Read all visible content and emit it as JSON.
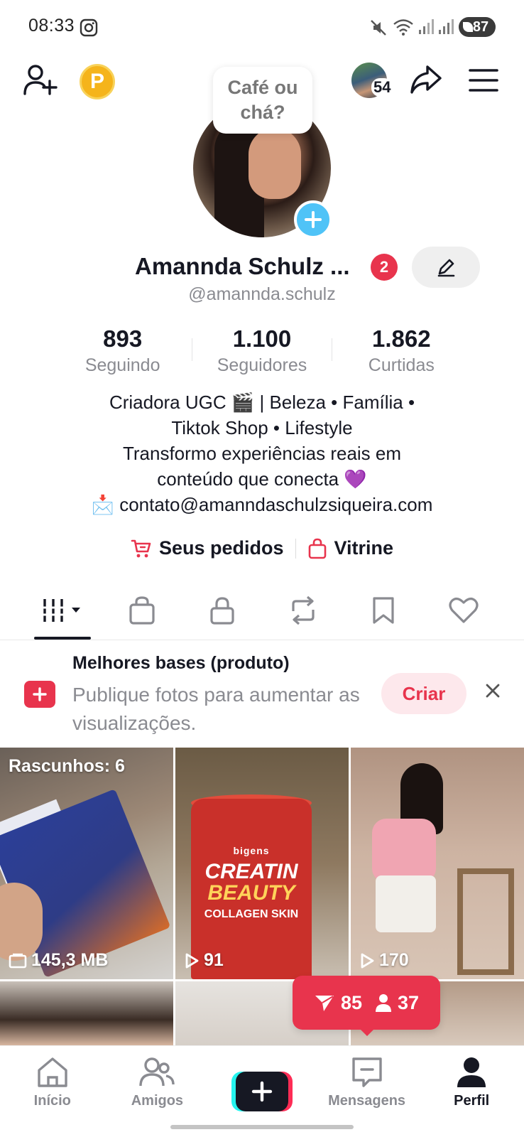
{
  "status_bar": {
    "time": "08:33",
    "battery": "87"
  },
  "top_bar": {
    "coin_label": "P",
    "visitor_count": "54"
  },
  "profile": {
    "note_bubble": "Café ou chá?",
    "display_name": "Amannda Schulz ...",
    "notification_count": "2",
    "handle": "@amannda.schulz",
    "stats": [
      {
        "value": "893",
        "label": "Seguindo"
      },
      {
        "value": "1.100",
        "label": "Seguidores"
      },
      {
        "value": "1.862",
        "label": "Curtidas"
      }
    ],
    "bio_lines": [
      "Criadora UGC 🎬 | Beleza • Família •",
      "Tiktok Shop • Lifestyle",
      "Transformo experiências reais em",
      "conteúdo que conecta 💜",
      "📩 contato@amanndaschulzsiqueira.com"
    ],
    "links": {
      "orders": "Seus pedidos",
      "showcase": "Vitrine"
    }
  },
  "tabs": [
    {
      "icon": "grid-icon",
      "active": true
    },
    {
      "icon": "shopping-bag-icon"
    },
    {
      "icon": "lock-icon"
    },
    {
      "icon": "repost-icon"
    },
    {
      "icon": "bookmark-icon"
    },
    {
      "icon": "heart-icon"
    }
  ],
  "prompt_card": {
    "title": "Melhores bases (produto)",
    "subtitle": "Publique fotos para aumentar as visualizações.",
    "create_label": "Criar"
  },
  "grid": [
    {
      "drafts_label": "Rascunhos: 6",
      "bottom_label": "145,3 MB",
      "bottom_icon": "folder-icon"
    },
    {
      "bottom_label": "91",
      "bottom_icon": "play-icon",
      "product_text": {
        "brand": "bigens",
        "line1": "CREATIN",
        "line2": "BEAUTY",
        "line3": "COLLAGEN SKIN"
      }
    },
    {
      "bottom_label": "170",
      "bottom_icon": "play-icon"
    }
  ],
  "floating_stats": {
    "views": "85",
    "followers": "37"
  },
  "bottom_nav": [
    {
      "label": "Início",
      "icon": "home-icon"
    },
    {
      "label": "Amigos",
      "icon": "friends-icon"
    },
    {
      "label": "",
      "icon": "plus-icon"
    },
    {
      "label": "Mensagens",
      "icon": "message-icon"
    },
    {
      "label": "Perfil",
      "icon": "profile-icon",
      "active": true
    }
  ],
  "colors": {
    "accent": "#e8344d",
    "text": "#161823",
    "muted": "#8a8b91"
  }
}
